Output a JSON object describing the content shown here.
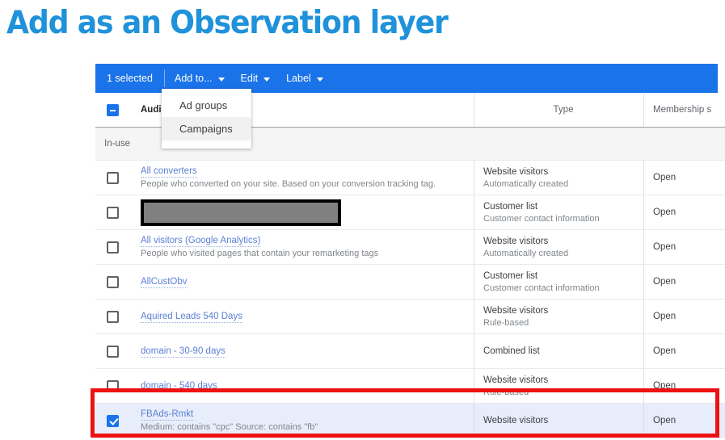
{
  "title": "Add as an Observation layer",
  "colors": {
    "title_blue": "#1f92da",
    "toolbar_blue": "#1a73e8",
    "link_blue": "#5b7fd4",
    "annotation_red": "#ee1111",
    "selected_row": "#e8edfb",
    "redaction_gray": "#808080"
  },
  "toolbar": {
    "selected_count_label": "1 selected",
    "add_to_label": "Add to...",
    "edit_label": "Edit",
    "label_label": "Label"
  },
  "dropdown": {
    "items": [
      {
        "label": "Ad groups",
        "hovered": false
      },
      {
        "label": "Campaigns",
        "hovered": true
      }
    ]
  },
  "table": {
    "headers": {
      "audience": "Audien",
      "type": "Type",
      "membership_status": "Membership s"
    },
    "group_label": "In-use",
    "rows": [
      {
        "checked": false,
        "redacted": false,
        "name": "All converters",
        "desc": "People who converted on your site. Based on your conversion tracking tag.",
        "type_main": "Website visitors",
        "type_sub": "Automatically created",
        "membership": "Open"
      },
      {
        "checked": false,
        "redacted": true,
        "name": "",
        "desc": "",
        "type_main": "Customer list",
        "type_sub": "Customer contact information",
        "membership": "Open"
      },
      {
        "checked": false,
        "redacted": false,
        "name": "All visitors (Google Analytics)",
        "desc": "People who visited pages that contain your remarketing tags",
        "type_main": "Website visitors",
        "type_sub": "Automatically created",
        "membership": "Open"
      },
      {
        "checked": false,
        "redacted": false,
        "name": "AllCustObv",
        "desc": "",
        "type_main": "Customer list",
        "type_sub": "Customer contact information",
        "membership": "Open"
      },
      {
        "checked": false,
        "redacted": false,
        "name": "Aquired Leads 540 Days",
        "desc": "",
        "type_main": "Website visitors",
        "type_sub": "Rule-based",
        "membership": "Open"
      },
      {
        "checked": false,
        "redacted": false,
        "name": "domain - 30-90 days",
        "desc": "",
        "type_main": "Combined list",
        "type_sub": "",
        "membership": "Open"
      },
      {
        "checked": false,
        "redacted": false,
        "name": "domain - 540 days",
        "desc": "",
        "type_main": "Website visitors",
        "type_sub": "Rule-based",
        "membership": "Open"
      },
      {
        "checked": true,
        "redacted": false,
        "name": "FBAds-Rmkt",
        "desc": "Medium: contains \"cpc\" Source: contains \"fb\"",
        "type_main": "Website visitors",
        "type_sub": "",
        "membership": "Open"
      }
    ]
  }
}
